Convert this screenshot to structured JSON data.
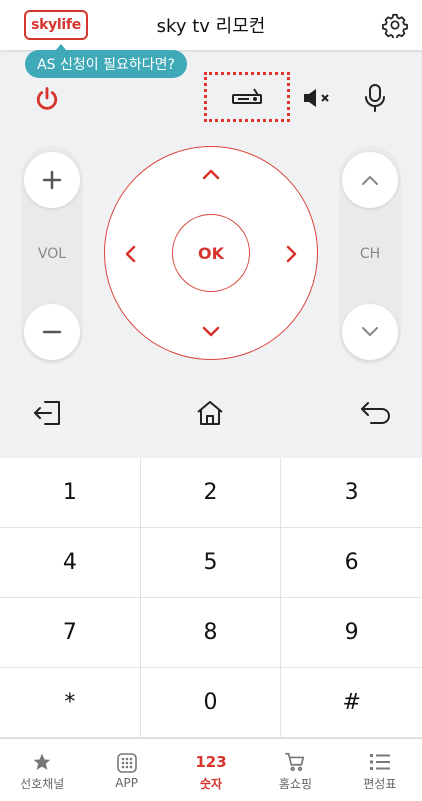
{
  "header": {
    "logo_text": "skylife",
    "title": "sky tv 리모컨",
    "settings_icon": "gear-icon"
  },
  "tooltip": {
    "text": "AS 신청이 필요하다면?"
  },
  "remote": {
    "power_icon": "power-icon",
    "settop_icon": "set-top-box-icon",
    "mute_icon": "mute-icon",
    "mic_icon": "microphone-icon",
    "vol": {
      "label": "VOL",
      "up_icon": "plus-icon",
      "down_icon": "minus-icon"
    },
    "ch": {
      "label": "CH",
      "up_icon": "chevron-up-icon",
      "down_icon": "chevron-down-icon"
    },
    "dpad": {
      "ok_label": "OK"
    },
    "exit_icon": "exit-icon",
    "home_icon": "home-icon",
    "back_icon": "back-icon"
  },
  "keypad": {
    "keys": [
      "1",
      "2",
      "3",
      "4",
      "5",
      "6",
      "7",
      "8",
      "9",
      "*",
      "0",
      "#"
    ]
  },
  "bottom_nav": {
    "items": [
      {
        "label": "선호채널",
        "icon": "star-icon"
      },
      {
        "label": "APP",
        "icon": "app-grid-icon"
      },
      {
        "label": "숫자",
        "icon_text": "123"
      },
      {
        "label": "홈쇼핑",
        "icon": "shopping-cart-icon"
      },
      {
        "label": "편성표",
        "icon": "list-icon"
      }
    ],
    "active_index": 2
  },
  "colors": {
    "accent": "#d6342c",
    "tooltip": "#3fa9b8",
    "remote_bg": "#f0f1f3"
  }
}
